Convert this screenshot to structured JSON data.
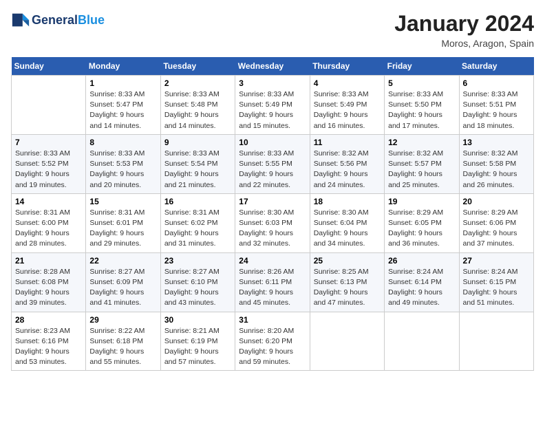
{
  "header": {
    "logo_line1": "General",
    "logo_line2": "Blue",
    "month": "January 2024",
    "location": "Moros, Aragon, Spain"
  },
  "weekdays": [
    "Sunday",
    "Monday",
    "Tuesday",
    "Wednesday",
    "Thursday",
    "Friday",
    "Saturday"
  ],
  "weeks": [
    [
      {
        "day": "",
        "info": ""
      },
      {
        "day": "1",
        "info": "Sunrise: 8:33 AM\nSunset: 5:47 PM\nDaylight: 9 hours\nand 14 minutes."
      },
      {
        "day": "2",
        "info": "Sunrise: 8:33 AM\nSunset: 5:48 PM\nDaylight: 9 hours\nand 14 minutes."
      },
      {
        "day": "3",
        "info": "Sunrise: 8:33 AM\nSunset: 5:49 PM\nDaylight: 9 hours\nand 15 minutes."
      },
      {
        "day": "4",
        "info": "Sunrise: 8:33 AM\nSunset: 5:49 PM\nDaylight: 9 hours\nand 16 minutes."
      },
      {
        "day": "5",
        "info": "Sunrise: 8:33 AM\nSunset: 5:50 PM\nDaylight: 9 hours\nand 17 minutes."
      },
      {
        "day": "6",
        "info": "Sunrise: 8:33 AM\nSunset: 5:51 PM\nDaylight: 9 hours\nand 18 minutes."
      }
    ],
    [
      {
        "day": "7",
        "info": "Sunrise: 8:33 AM\nSunset: 5:52 PM\nDaylight: 9 hours\nand 19 minutes."
      },
      {
        "day": "8",
        "info": "Sunrise: 8:33 AM\nSunset: 5:53 PM\nDaylight: 9 hours\nand 20 minutes."
      },
      {
        "day": "9",
        "info": "Sunrise: 8:33 AM\nSunset: 5:54 PM\nDaylight: 9 hours\nand 21 minutes."
      },
      {
        "day": "10",
        "info": "Sunrise: 8:33 AM\nSunset: 5:55 PM\nDaylight: 9 hours\nand 22 minutes."
      },
      {
        "day": "11",
        "info": "Sunrise: 8:32 AM\nSunset: 5:56 PM\nDaylight: 9 hours\nand 24 minutes."
      },
      {
        "day": "12",
        "info": "Sunrise: 8:32 AM\nSunset: 5:57 PM\nDaylight: 9 hours\nand 25 minutes."
      },
      {
        "day": "13",
        "info": "Sunrise: 8:32 AM\nSunset: 5:58 PM\nDaylight: 9 hours\nand 26 minutes."
      }
    ],
    [
      {
        "day": "14",
        "info": "Sunrise: 8:31 AM\nSunset: 6:00 PM\nDaylight: 9 hours\nand 28 minutes."
      },
      {
        "day": "15",
        "info": "Sunrise: 8:31 AM\nSunset: 6:01 PM\nDaylight: 9 hours\nand 29 minutes."
      },
      {
        "day": "16",
        "info": "Sunrise: 8:31 AM\nSunset: 6:02 PM\nDaylight: 9 hours\nand 31 minutes."
      },
      {
        "day": "17",
        "info": "Sunrise: 8:30 AM\nSunset: 6:03 PM\nDaylight: 9 hours\nand 32 minutes."
      },
      {
        "day": "18",
        "info": "Sunrise: 8:30 AM\nSunset: 6:04 PM\nDaylight: 9 hours\nand 34 minutes."
      },
      {
        "day": "19",
        "info": "Sunrise: 8:29 AM\nSunset: 6:05 PM\nDaylight: 9 hours\nand 36 minutes."
      },
      {
        "day": "20",
        "info": "Sunrise: 8:29 AM\nSunset: 6:06 PM\nDaylight: 9 hours\nand 37 minutes."
      }
    ],
    [
      {
        "day": "21",
        "info": "Sunrise: 8:28 AM\nSunset: 6:08 PM\nDaylight: 9 hours\nand 39 minutes."
      },
      {
        "day": "22",
        "info": "Sunrise: 8:27 AM\nSunset: 6:09 PM\nDaylight: 9 hours\nand 41 minutes."
      },
      {
        "day": "23",
        "info": "Sunrise: 8:27 AM\nSunset: 6:10 PM\nDaylight: 9 hours\nand 43 minutes."
      },
      {
        "day": "24",
        "info": "Sunrise: 8:26 AM\nSunset: 6:11 PM\nDaylight: 9 hours\nand 45 minutes."
      },
      {
        "day": "25",
        "info": "Sunrise: 8:25 AM\nSunset: 6:13 PM\nDaylight: 9 hours\nand 47 minutes."
      },
      {
        "day": "26",
        "info": "Sunrise: 8:24 AM\nSunset: 6:14 PM\nDaylight: 9 hours\nand 49 minutes."
      },
      {
        "day": "27",
        "info": "Sunrise: 8:24 AM\nSunset: 6:15 PM\nDaylight: 9 hours\nand 51 minutes."
      }
    ],
    [
      {
        "day": "28",
        "info": "Sunrise: 8:23 AM\nSunset: 6:16 PM\nDaylight: 9 hours\nand 53 minutes."
      },
      {
        "day": "29",
        "info": "Sunrise: 8:22 AM\nSunset: 6:18 PM\nDaylight: 9 hours\nand 55 minutes."
      },
      {
        "day": "30",
        "info": "Sunrise: 8:21 AM\nSunset: 6:19 PM\nDaylight: 9 hours\nand 57 minutes."
      },
      {
        "day": "31",
        "info": "Sunrise: 8:20 AM\nSunset: 6:20 PM\nDaylight: 9 hours\nand 59 minutes."
      },
      {
        "day": "",
        "info": ""
      },
      {
        "day": "",
        "info": ""
      },
      {
        "day": "",
        "info": ""
      }
    ]
  ]
}
